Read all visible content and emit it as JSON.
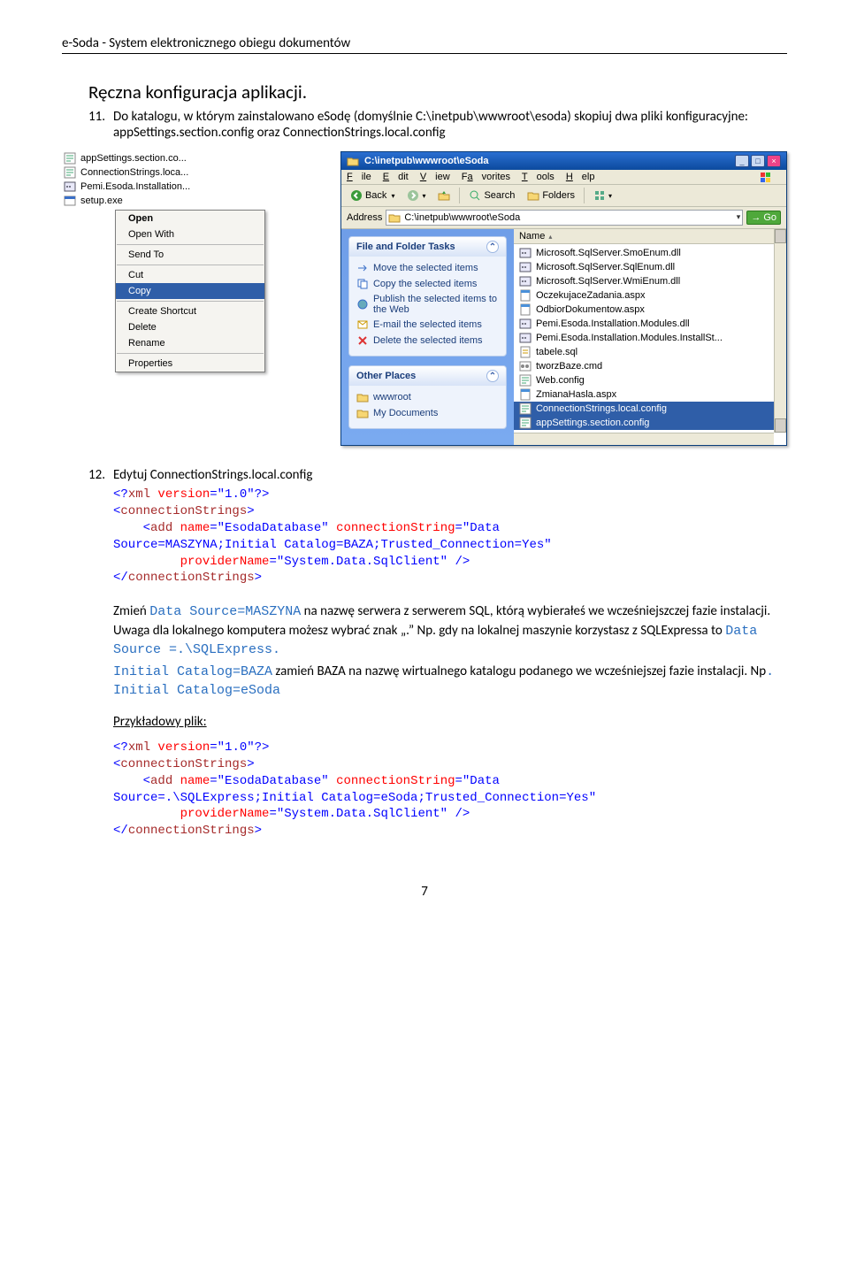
{
  "header": "e-Soda - System elektronicznego obiegu dokumentów",
  "doc": {
    "section_title": "Ręczna konfiguracja aplikacji.",
    "item11_num": "11.",
    "item11_text": "Do katalogu, w którym zainstalowano eSodę (domyślnie C:\\inetpub\\wwwroot\\esoda) skopiuj dwa pliki konfiguracyjne: appSettings.section.config oraz ConnectionStrings.local.config",
    "item12_num": "12.",
    "item12_text": "Edytuj ConnectionStrings.local.config"
  },
  "left_files": [
    "appSettings.section.co...",
    "ConnectionStrings.loca...",
    "Pemi.Esoda.Installation...",
    "setup.exe"
  ],
  "ctx": {
    "open": "Open",
    "openwith": "Open With",
    "sendto": "Send To",
    "cut": "Cut",
    "copy": "Copy",
    "shortcut": "Create Shortcut",
    "delete": "Delete",
    "rename": "Rename",
    "props": "Properties"
  },
  "explorer": {
    "title": "C:\\inetpub\\wwwroot\\eSoda",
    "menu": {
      "file": "File",
      "edit": "Edit",
      "view": "View",
      "fav": "Favorites",
      "tools": "Tools",
      "help": "Help"
    },
    "toolbar": {
      "back": "Back",
      "search": "Search",
      "folders": "Folders"
    },
    "address_label": "Address",
    "address_value": "C:\\inetpub\\wwwroot\\eSoda",
    "go": "Go",
    "side1_title": "File and Folder Tasks",
    "side1_items": [
      "Move the selected items",
      "Copy the selected items",
      "Publish the selected items to the Web",
      "E-mail the selected items",
      "Delete the selected items"
    ],
    "side2_title": "Other Places",
    "side2_items": [
      "wwwroot",
      "My Documents"
    ],
    "name_col": "Name",
    "files": [
      "Microsoft.SqlServer.SmoEnum.dll",
      "Microsoft.SqlServer.SqlEnum.dll",
      "Microsoft.SqlServer.WmiEnum.dll",
      "OczekujaceZadania.aspx",
      "OdbiorDokumentow.aspx",
      "Pemi.Esoda.Installation.Modules.dll",
      "Pemi.Esoda.Installation.Modules.InstallSt...",
      "tabele.sql",
      "tworzBaze.cmd",
      "Web.config",
      "ZmianaHasla.aspx",
      "ConnectionStrings.local.config",
      "appSettings.section.config"
    ]
  },
  "code1": {
    "l1a": "<?",
    "l1b": "xml",
    "l1c": " version",
    "l1d": "=\"1.0\"?>",
    "l2a": "<",
    "l2b": "connectionStrings",
    "l2c": ">",
    "l3a": "<",
    "l3b": "add",
    "l3c": " name",
    "l3d": "=\"EsodaDatabase\"",
    "l3e": " connectionString",
    "l3f": "=\"Data",
    "l4": "Source=MASZYNA;Initial Catalog=BAZA;Trusted_Connection=Yes\"",
    "l5a": " providerName",
    "l5b": "=\"System.Data.SqlClient\"",
    "l5c": " />",
    "l6a": "</",
    "l6b": "connectionStrings",
    "l6c": ">"
  },
  "prose": {
    "p1_a": "Zmień ",
    "p1_code1": "Data Source=MASZYNA",
    "p1_b": "  na nazwę serwera z serwerem SQL, którą wybierałeś we wcześniejszczej fazie instalacji. Uwaga dla lokalnego komputera możesz wybrać znak „.” Np. gdy na lokalnej maszynie korzystasz z SQLExpressa to ",
    "p1_code2": "Data Source =.\\SQLExpress.",
    "p2_code1": "Initial Catalog=BAZA",
    "p2_a": "  zamień BAZA na nazwę wirtualnego katalogu podanego we wcześniejszej fazie instalacji. Np",
    "p2_code2": ". Initial Catalog=eSoda",
    "example": "Przykładowy plik:"
  },
  "code2": {
    "l1a": "<?",
    "l1b": "xml",
    "l1c": " version",
    "l1d": "=\"1.0\"?>",
    "l2a": "<",
    "l2b": "connectionStrings",
    "l2c": ">",
    "l3a": "<",
    "l3b": "add",
    "l3c": " name",
    "l3d": "=\"EsodaDatabase\"",
    "l3e": " connectionString",
    "l3f": "=\"Data",
    "l4": "Source=.\\SQLExpress;Initial Catalog=eSoda;Trusted_Connection=Yes\"",
    "l5a": " providerName",
    "l5b": "=\"System.Data.SqlClient\"",
    "l5c": " />",
    "l6a": "</",
    "l6b": "connectionStrings",
    "l6c": ">"
  },
  "page_num": "7"
}
